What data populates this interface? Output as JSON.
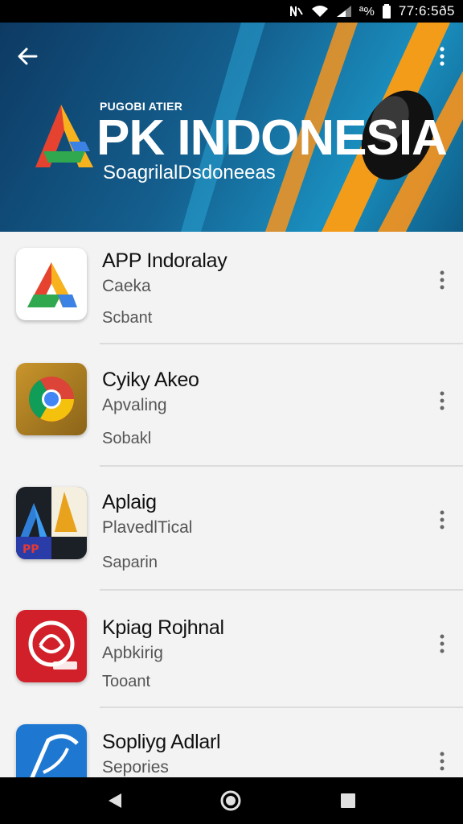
{
  "status_bar": {
    "time": "77:6:5ð5",
    "battery_text": "ª%",
    "icons": [
      "nfc-icon",
      "wifi-icon",
      "signal-icon",
      "battery-icon"
    ]
  },
  "header": {
    "small_text": "PUGOBI ATIER",
    "title": "PK INDONESIA",
    "subtitle": "SoagrilalDsdoneeas",
    "back_icon": "arrow-left-icon",
    "menu_icon": "more-vert-icon",
    "colors": {
      "banner_dark": "#0d3a63",
      "banner_light": "#1a8fbf",
      "accent": "#f7941d"
    }
  },
  "apps": [
    {
      "title": "APP Indoralay",
      "line1": "Caeka",
      "line2": "Scbant",
      "icon": "apk-logo-icon"
    },
    {
      "title": "Cyiky Akeo",
      "line1": "Apvaling",
      "line2": "Sobakl",
      "icon": "chrome-logo-icon"
    },
    {
      "title": "Aplaig",
      "line1": "PlavedlTical",
      "line2": "Saparin",
      "icon": "aplaig-logo-icon"
    },
    {
      "title": "Kpiag Rojhnal",
      "line1": "Apbkirig",
      "line2": "Tooant",
      "icon": "red-swirl-logo-icon"
    },
    {
      "title": "Sopliyg Adlarl",
      "line1": "Sepories",
      "line2": "",
      "icon": "blue-bird-logo-icon"
    }
  ],
  "nav_bar": {
    "buttons": [
      "back-triangle-icon",
      "home-circle-icon",
      "recents-square-icon"
    ]
  }
}
